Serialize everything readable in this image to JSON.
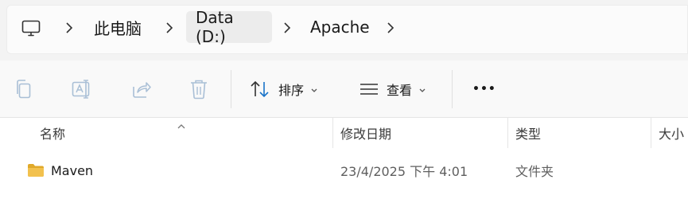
{
  "breadcrumb": {
    "items": [
      {
        "label": "此电脑"
      },
      {
        "label": "Data (D:)"
      },
      {
        "label": "Apache"
      }
    ]
  },
  "toolbar": {
    "sort_label": "排序",
    "view_label": "查看",
    "more_label": "•••"
  },
  "columns": {
    "name": "名称",
    "date": "修改日期",
    "type": "类型",
    "size": "大小"
  },
  "rows": [
    {
      "name": "Maven",
      "date": "23/4/2025 下午 4:01",
      "type": "文件夹"
    }
  ],
  "colors": {
    "folder": "#f2c14e",
    "folder_dark": "#e0a92a",
    "icon_disabled": "#a9bfd6",
    "icon_gray": "#8a8a8a",
    "accent": "#1a73c8"
  }
}
